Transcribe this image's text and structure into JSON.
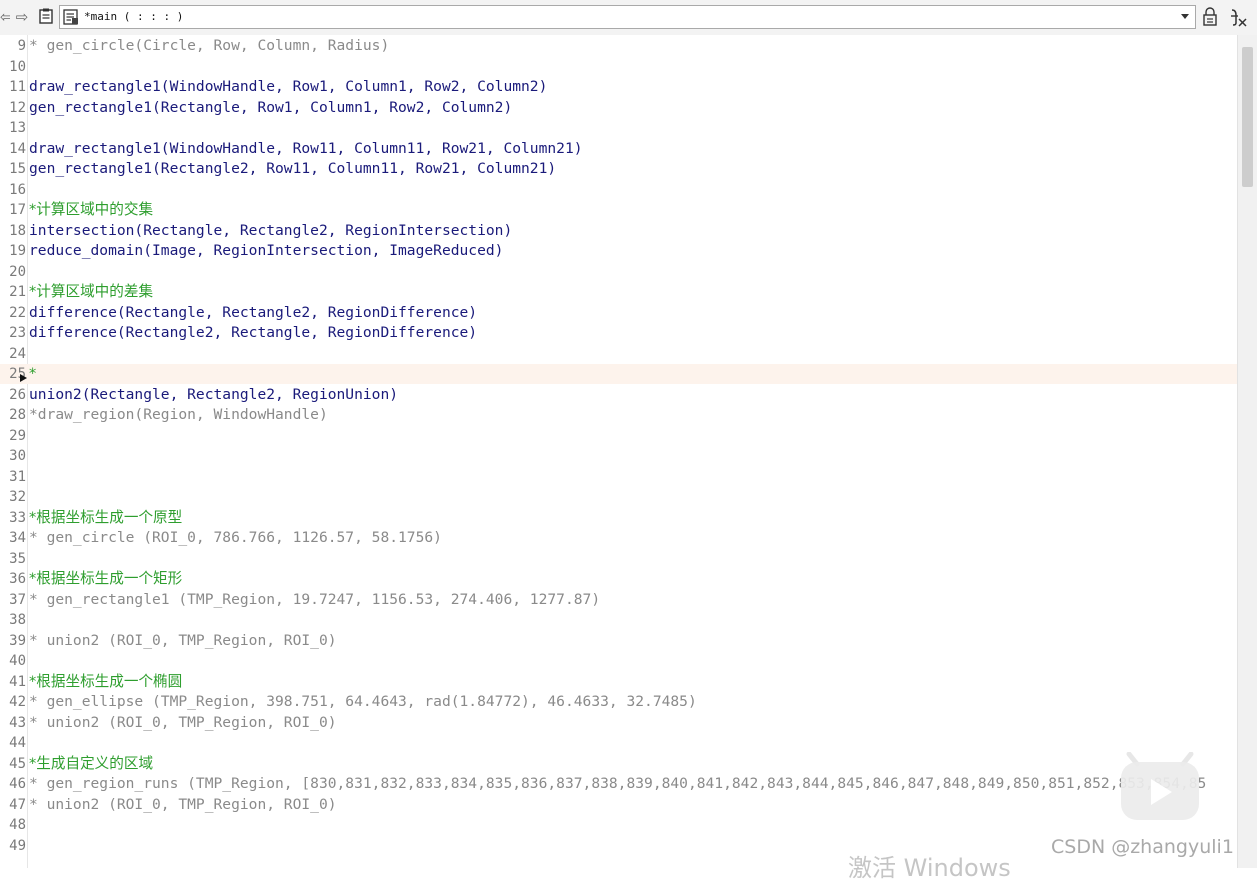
{
  "toolbar": {
    "back_icon": "⇦",
    "forward_icon": "⇨",
    "procedure_select": {
      "value": "*main ( : : : )"
    },
    "icons": [
      "back-arrow-icon",
      "forward-arrow-icon",
      "clipboard-icon",
      "procedure-icon",
      "chevron-down-icon",
      "lock-icon",
      "clear-variable-icon"
    ]
  },
  "editor": {
    "current_line": 25,
    "lines": [
      {
        "n": "9",
        "text": "* gen_circle(Circle, Row, Column, Radius)",
        "kind": "comment"
      },
      {
        "n": "10",
        "text": "",
        "kind": "code"
      },
      {
        "n": "11",
        "text": "draw_rectangle1(WindowHandle, Row1, Column1, Row2, Column2)",
        "kind": "code"
      },
      {
        "n": "12",
        "text": "gen_rectangle1(Rectangle, Row1, Column1, Row2, Column2)",
        "kind": "code"
      },
      {
        "n": "13",
        "text": "",
        "kind": "code"
      },
      {
        "n": "14",
        "text": "draw_rectangle1(WindowHandle, Row11, Column11, Row21, Column21)",
        "kind": "code"
      },
      {
        "n": "15",
        "text": "gen_rectangle1(Rectangle2, Row11, Column11, Row21, Column21)",
        "kind": "code"
      },
      {
        "n": "16",
        "text": "",
        "kind": "code"
      },
      {
        "n": "17",
        "text": "*计算区域中的交集",
        "kind": "green"
      },
      {
        "n": "18",
        "text": "intersection(Rectangle, Rectangle2, RegionIntersection)",
        "kind": "code"
      },
      {
        "n": "19",
        "text": "reduce_domain(Image, RegionIntersection, ImageReduced)",
        "kind": "code"
      },
      {
        "n": "20",
        "text": "",
        "kind": "code"
      },
      {
        "n": "21",
        "text": "*计算区域中的差集",
        "kind": "green"
      },
      {
        "n": "22",
        "text": "difference(Rectangle, Rectangle2, RegionDifference)",
        "kind": "code"
      },
      {
        "n": "23",
        "text": "difference(Rectangle2, Rectangle, RegionDifference)",
        "kind": "code"
      },
      {
        "n": "24",
        "text": "",
        "kind": "code"
      },
      {
        "n": "25",
        "text": "*",
        "kind": "green"
      },
      {
        "n": "26",
        "text": "union2(Rectangle, Rectangle2, RegionUnion)",
        "kind": "code"
      },
      {
        "n": "28",
        "text": "*draw_region(Region, WindowHandle)",
        "kind": "comment"
      },
      {
        "n": "29",
        "text": "",
        "kind": "code"
      },
      {
        "n": "30",
        "text": "",
        "kind": "code"
      },
      {
        "n": "31",
        "text": "",
        "kind": "code"
      },
      {
        "n": "32",
        "text": "",
        "kind": "code"
      },
      {
        "n": "33",
        "text": "*根据坐标生成一个原型",
        "kind": "green"
      },
      {
        "n": "34",
        "text": "* gen_circle (ROI_0, 786.766, 1126.57, 58.1756)",
        "kind": "comment"
      },
      {
        "n": "35",
        "text": "",
        "kind": "code"
      },
      {
        "n": "36",
        "text": "*根据坐标生成一个矩形",
        "kind": "green"
      },
      {
        "n": "37",
        "text": "* gen_rectangle1 (TMP_Region, 19.7247, 1156.53, 274.406, 1277.87)",
        "kind": "comment"
      },
      {
        "n": "38",
        "text": "",
        "kind": "code"
      },
      {
        "n": "39",
        "text": "* union2 (ROI_0, TMP_Region, ROI_0)",
        "kind": "comment"
      },
      {
        "n": "40",
        "text": "",
        "kind": "code"
      },
      {
        "n": "41",
        "text": "*根据坐标生成一个椭圆",
        "kind": "green"
      },
      {
        "n": "42",
        "text": "* gen_ellipse (TMP_Region, 398.751, 64.4643, rad(1.84772), 46.4633, 32.7485)",
        "kind": "comment"
      },
      {
        "n": "43",
        "text": "* union2 (ROI_0, TMP_Region, ROI_0)",
        "kind": "comment"
      },
      {
        "n": "44",
        "text": "",
        "kind": "code"
      },
      {
        "n": "45",
        "text": "*生成自定义的区域",
        "kind": "green"
      },
      {
        "n": "46",
        "text": "* gen_region_runs (TMP_Region, [830,831,832,833,834,835,836,837,838,839,840,841,842,843,844,845,846,847,848,849,850,851,852,853,854,85",
        "kind": "comment"
      },
      {
        "n": "47",
        "text": "* union2 (ROI_0, TMP_Region, ROI_0)",
        "kind": "comment"
      },
      {
        "n": "48",
        "text": "",
        "kind": "code"
      },
      {
        "n": "49",
        "text": "",
        "kind": "code"
      }
    ]
  },
  "watermark": "CSDN @zhangyuli1",
  "windows_activation": "激活 Windows"
}
